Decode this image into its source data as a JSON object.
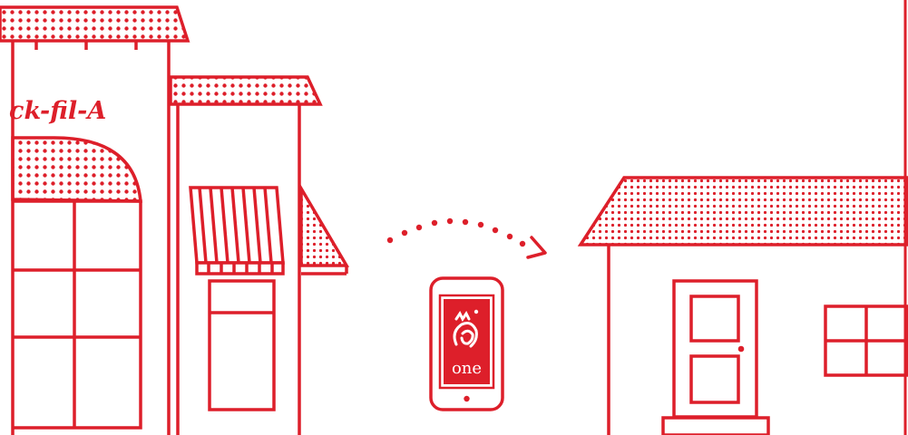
{
  "colors": {
    "brand_red": "#dd1f2a",
    "background": "#ffffff"
  },
  "storefront": {
    "sign_text": "ck-fil-A"
  },
  "phone": {
    "app_label": "one",
    "logo_icon": "chicken-logo-icon"
  },
  "icons": {
    "transfer": "dotted-arrow-icon"
  }
}
